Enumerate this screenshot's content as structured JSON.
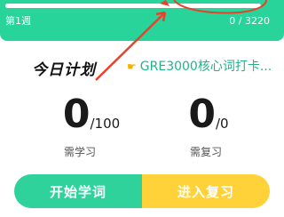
{
  "progress": {
    "week_label": "第1週",
    "count_text": "0 / 3220",
    "fraction": 0.0
  },
  "plan": {
    "title": "今日计划",
    "deck_icon": "pointing-hand-icon",
    "deck_name": "GRE3000核心词打卡..."
  },
  "stats": {
    "learn": {
      "value": "0",
      "total": "/100",
      "label": "需学习"
    },
    "review": {
      "value": "0",
      "total": "/0",
      "label": "需复习"
    }
  },
  "buttons": {
    "start_label": "开始学词",
    "review_label": "进入复习"
  },
  "colors": {
    "accent_green": "#29d49a",
    "review_yellow": "#ffd23a",
    "annotation_red": "#e8412c"
  }
}
